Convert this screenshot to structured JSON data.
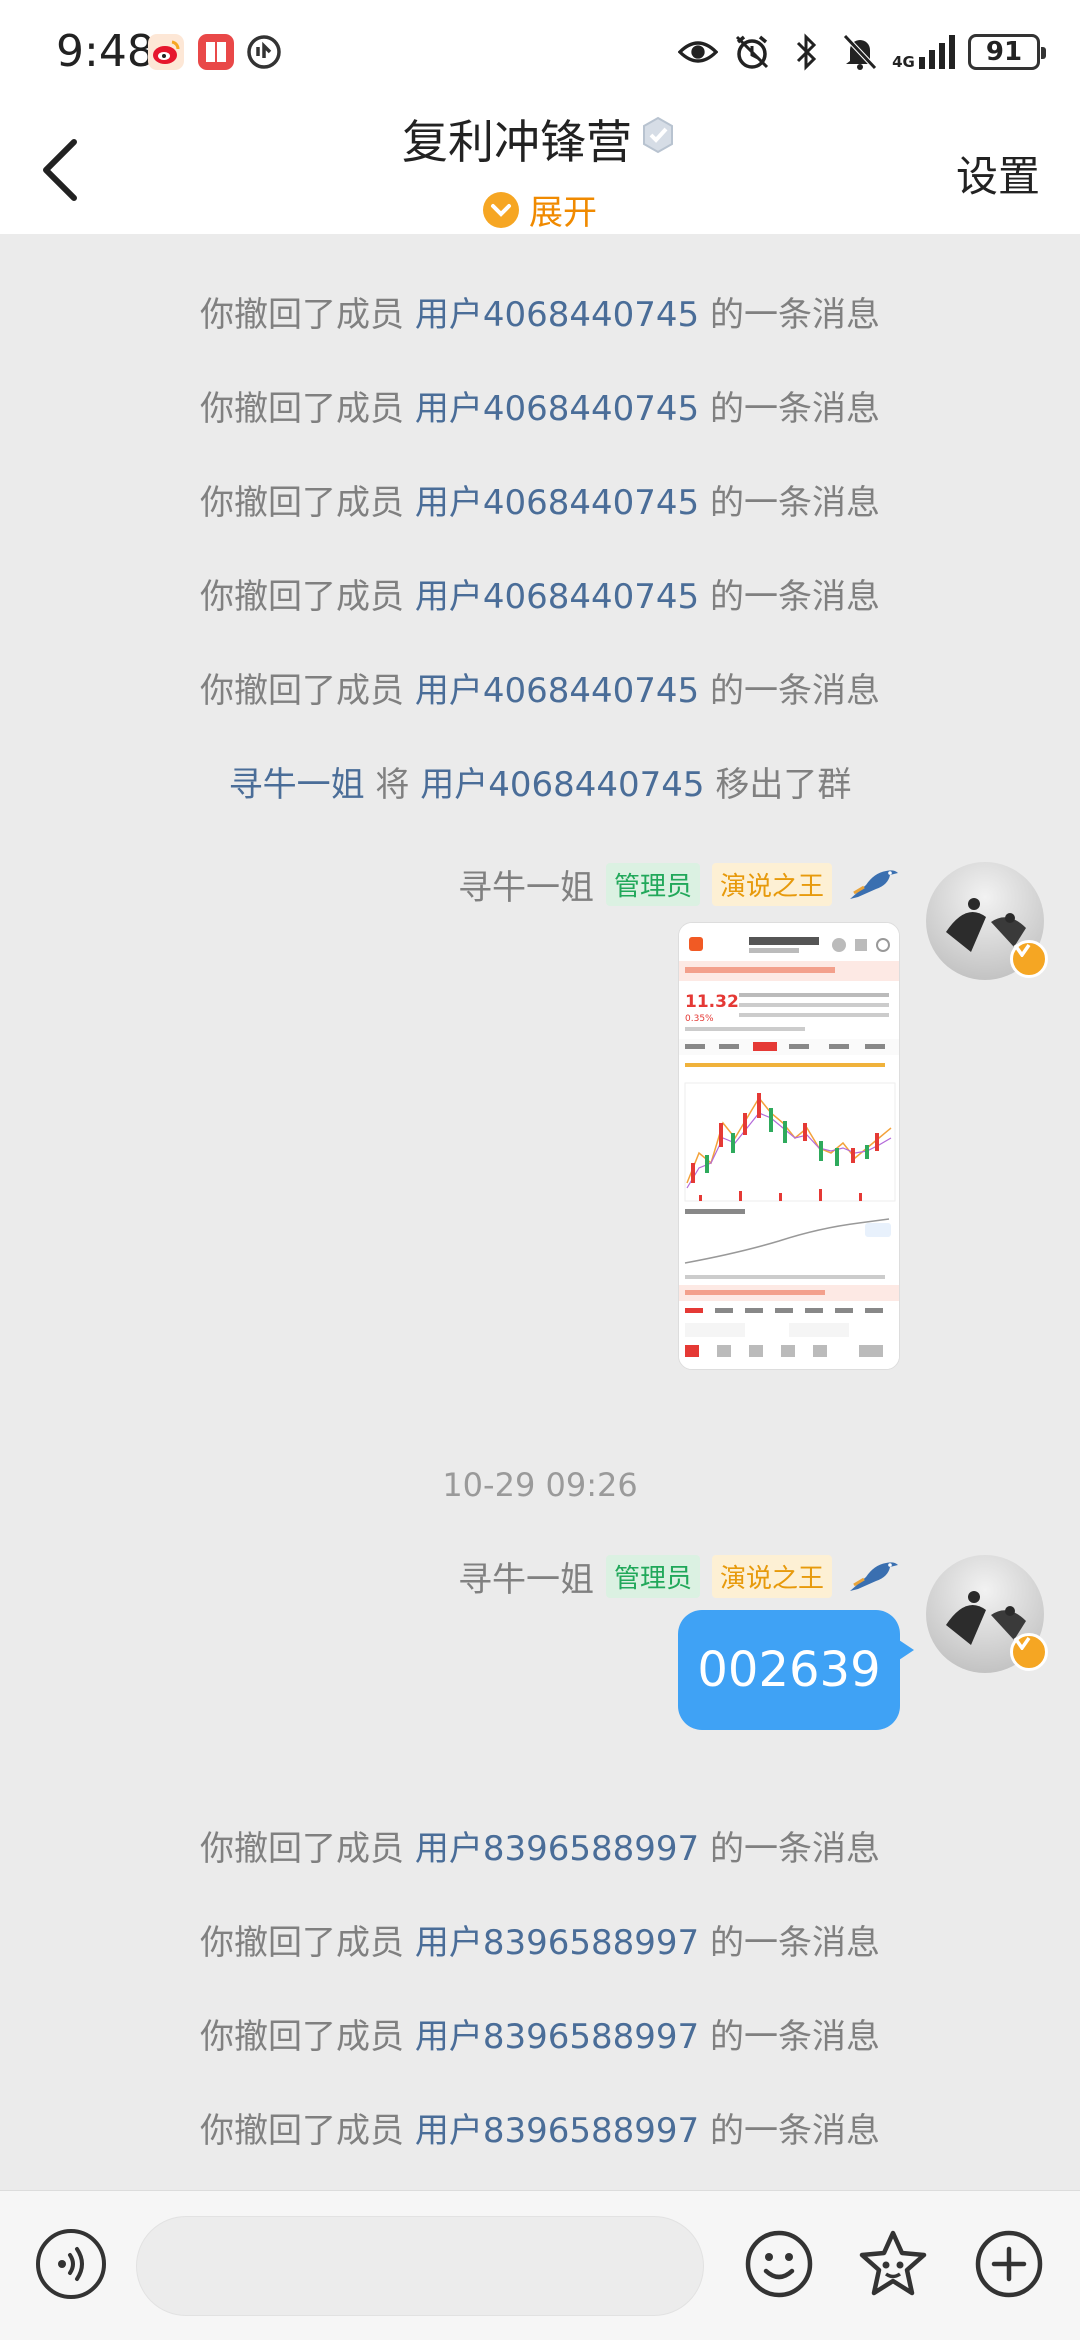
{
  "status_bar": {
    "time": "9:48",
    "network": "4G",
    "battery": "91",
    "app_icons": [
      "weibo-icon",
      "book-app-icon",
      "sync-app-icon"
    ],
    "right_icons": [
      "eye-icon",
      "alarm-icon",
      "bluetooth-icon",
      "mute-icon",
      "signal-icon",
      "battery-icon"
    ]
  },
  "header": {
    "title": "复利冲锋营",
    "expand_label": "展开",
    "settings_label": "设置"
  },
  "system_messages_top": [
    {
      "prefix": "你撤回了成员 ",
      "user": "用户4068440745",
      "suffix": " 的一条消息"
    },
    {
      "prefix": "你撤回了成员 ",
      "user": "用户4068440745",
      "suffix": " 的一条消息"
    },
    {
      "prefix": "你撤回了成员 ",
      "user": "用户4068440745",
      "suffix": " 的一条消息"
    },
    {
      "prefix": "你撤回了成员 ",
      "user": "用户4068440745",
      "suffix": " 的一条消息"
    },
    {
      "prefix": "你撤回了成员 ",
      "user": "用户4068440745",
      "suffix": " 的一条消息"
    }
  ],
  "remove_message": {
    "actor": "寻牛一姐",
    "middle": " 将 ",
    "user": "用户4068440745",
    "suffix": " 移出了群"
  },
  "message_1": {
    "sender": "寻牛一姐",
    "badge_admin": "管理员",
    "badge_title": "演说之王",
    "type": "image",
    "image_preview": {
      "price": "11.32",
      "change": "0.35%"
    }
  },
  "timestamp": "10-29 09:26",
  "message_2": {
    "sender": "寻牛一姐",
    "badge_admin": "管理员",
    "badge_title": "演说之王",
    "text": "002639"
  },
  "system_messages_bottom": [
    {
      "prefix": "你撤回了成员 ",
      "user": "用户8396588997",
      "suffix": " 的一条消息"
    },
    {
      "prefix": "你撤回了成员 ",
      "user": "用户8396588997",
      "suffix": " 的一条消息"
    },
    {
      "prefix": "你撤回了成员 ",
      "user": "用户8396588997",
      "suffix": " 的一条消息"
    },
    {
      "prefix": "你撤回了成员 ",
      "user": "用户8396588997",
      "suffix": " 的一条消息"
    }
  ],
  "input_bar": {
    "text_value": "",
    "icons": [
      "voice-icon",
      "emoji-icon",
      "sticker-icon",
      "plus-icon"
    ]
  },
  "colors": {
    "background": "#ebebeb",
    "user_link": "#4a6d98",
    "system_text": "#808080",
    "bubble": "#3fa2f5",
    "accent_orange": "#f08a00",
    "admin_green": "#21a85a"
  }
}
